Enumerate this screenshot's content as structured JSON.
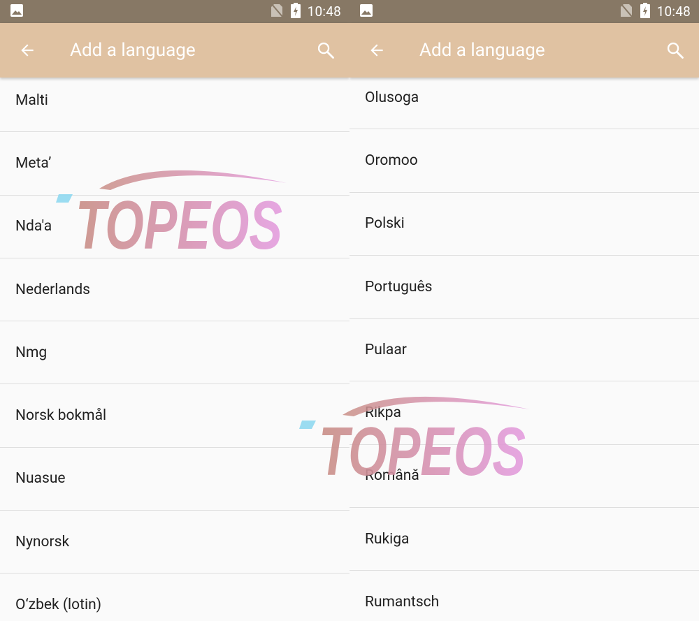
{
  "status_bar": {
    "time": "10:48",
    "icons": [
      "image-icon",
      "no-sim-icon",
      "battery-charging-icon"
    ]
  },
  "app_bar": {
    "title": "Add a language",
    "icons": [
      "back-arrow-icon",
      "search-icon"
    ]
  },
  "colors": {
    "status_bar": "#877865",
    "app_bar": "#e0c2a2",
    "list_background": "#fafafa",
    "divider": "#dedede",
    "text": "#212121"
  },
  "watermark": {
    "text": "TOPEOS"
  },
  "screens": [
    {
      "languages": [
        "Malti",
        "Meta’",
        "Nda'a",
        "Nederlands",
        "Nmg",
        "Norsk bokmål",
        "Nuasue",
        "Nynorsk",
        "O‘zbek (lotin)"
      ]
    },
    {
      "languages": [
        "Olusoga",
        "Oromoo",
        "Polski",
        "Português",
        "Pulaar",
        "Rikpa",
        "Română",
        "Rukiga",
        "Rumantsch"
      ]
    }
  ]
}
